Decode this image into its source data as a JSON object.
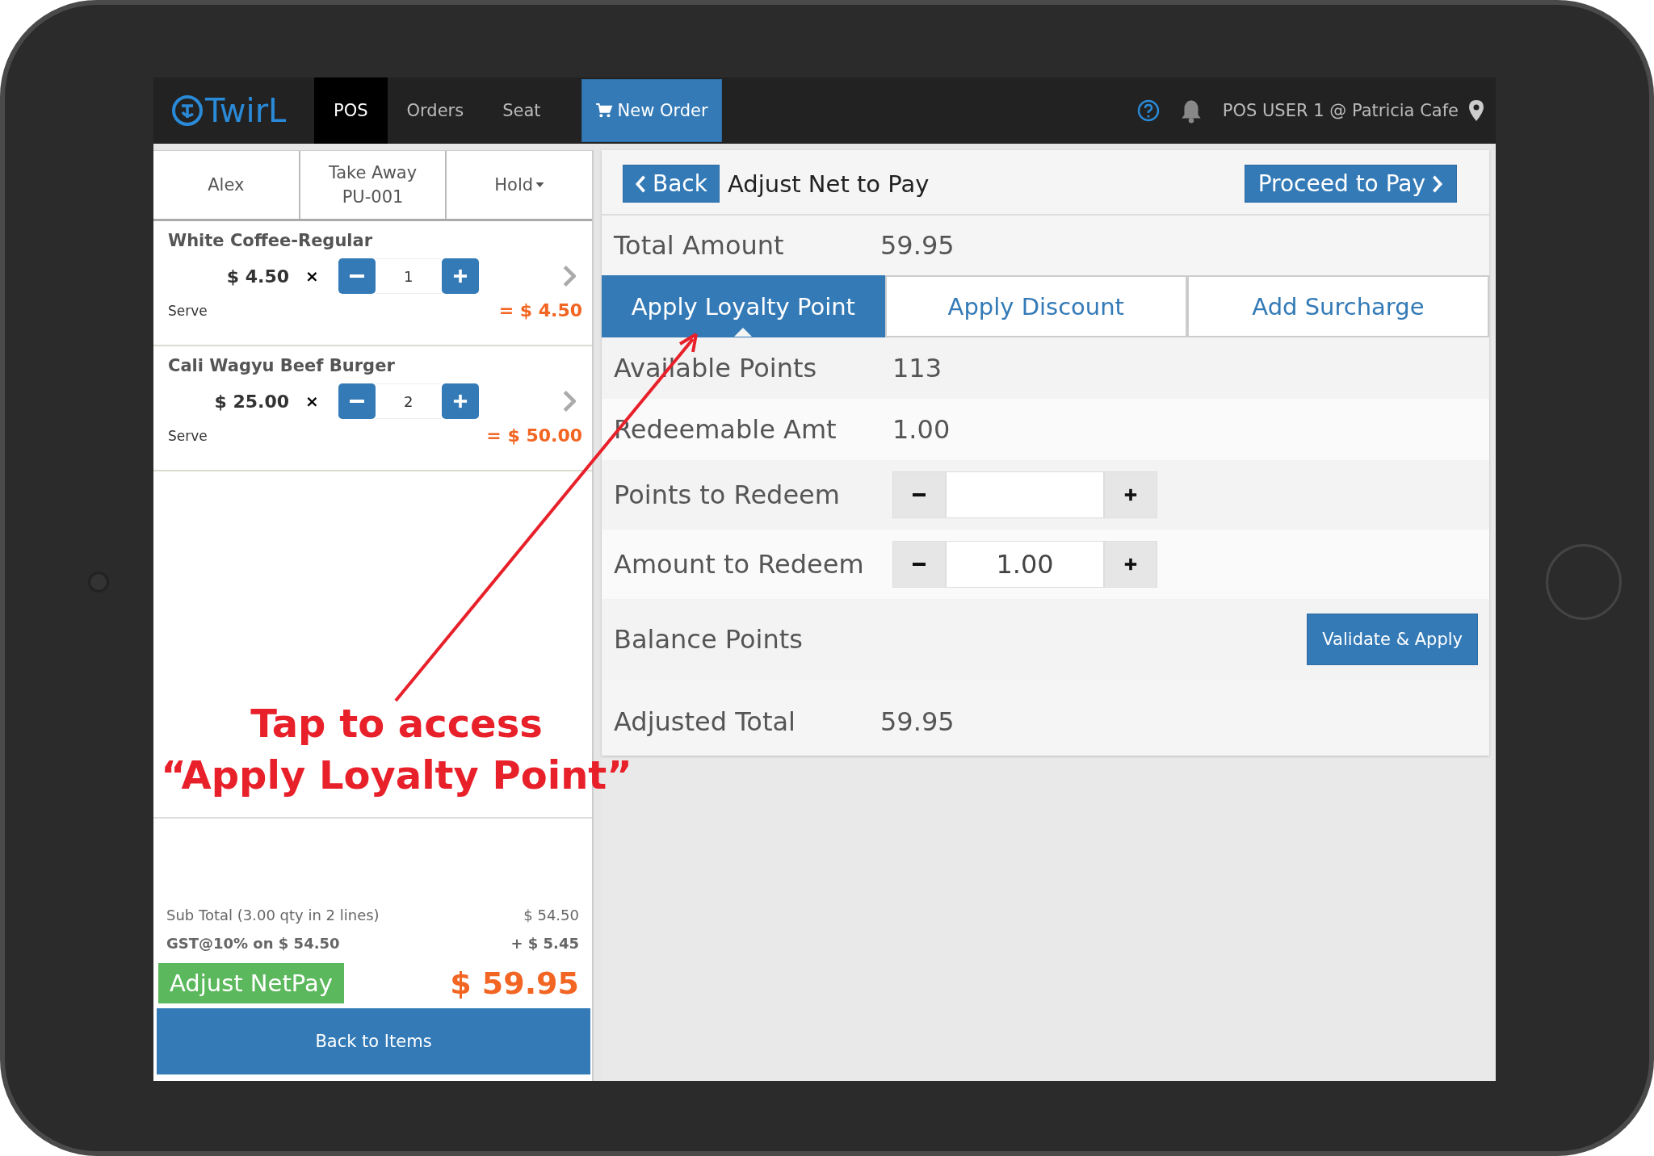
{
  "navbar": {
    "logo": "TwirL",
    "nav_items": [
      {
        "label": "POS",
        "selected": true
      },
      {
        "label": "Orders",
        "selected": false
      },
      {
        "label": "Seat",
        "selected": false
      }
    ],
    "new_order": "New Order",
    "user": "POS USER 1 @ Patricia Cafe"
  },
  "order_panel": {
    "tabs": [
      {
        "label": "Alex",
        "dropdown": false
      },
      {
        "label": "Take Away",
        "sub": "PU-001",
        "dropdown": false
      },
      {
        "label": "Hold",
        "dropdown": true
      }
    ],
    "items": [
      {
        "name": "White Coffee-Regular",
        "price": "$ 4.50",
        "times": "×",
        "qty": "1",
        "status": "Serve",
        "line_total": "= $ 4.50"
      },
      {
        "name": "Cali Wagyu Beef Burger",
        "price": "$ 25.00",
        "times": "×",
        "qty": "2",
        "status": "Serve",
        "line_total": "= $ 50.00"
      }
    ],
    "subtotal_label": "Sub Total (3.00 qty in 2 lines)",
    "subtotal_value": "$ 54.50",
    "tax_label": "GST@10% on $ 54.50",
    "tax_value": "+ $ 5.45",
    "adjust_button": "Adjust NetPay",
    "grand_total": "$ 59.95",
    "back_button": "Back to Items"
  },
  "adjust_panel": {
    "back_button": "Back",
    "title": "Adjust Net to Pay",
    "proceed_button": "Proceed to Pay",
    "total_label": "Total Amount",
    "total_value": "59.95",
    "tabs": [
      {
        "label": "Apply Loyalty Point",
        "selected": true
      },
      {
        "label": "Apply Discount",
        "selected": false
      },
      {
        "label": "Add Surcharge",
        "selected": false
      }
    ],
    "rows": [
      {
        "kind": "text",
        "label": "Available Points",
        "value": "113"
      },
      {
        "kind": "text",
        "label": "Redeemable Amt",
        "value": "1.00"
      },
      {
        "kind": "stepper",
        "label": "Points to Redeem"
      },
      {
        "kind": "stepper",
        "label": "Amount to Redeem",
        "value": "1.00"
      },
      {
        "kind": "action",
        "label": "Balance Points",
        "button": "Validate & Apply"
      }
    ],
    "adjusted_label": "Adjusted Total",
    "adjusted_value": "59.95"
  },
  "annotation": {
    "lines": [
      "Tap to access",
      "“Apply Loyalty Point”"
    ]
  }
}
